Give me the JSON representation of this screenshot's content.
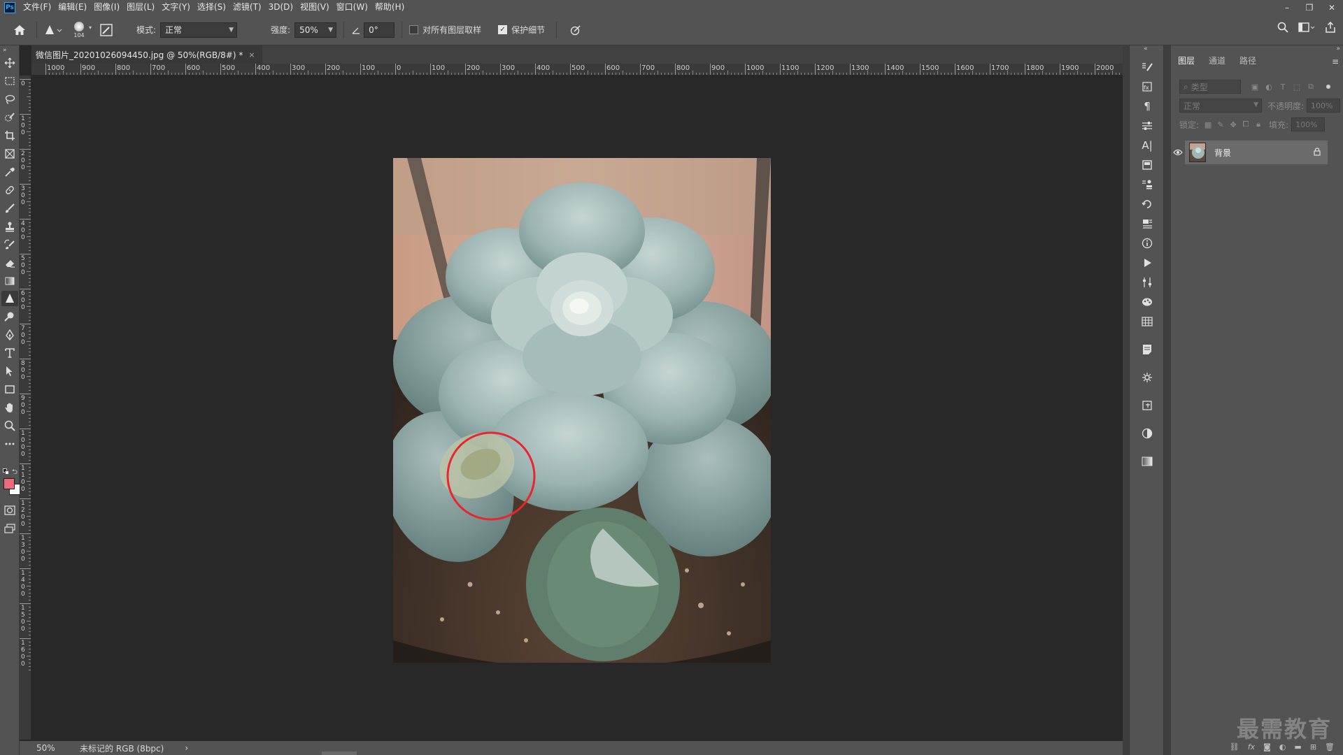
{
  "app": {
    "logo": "Ps"
  },
  "menu": [
    {
      "label": "文件(F)"
    },
    {
      "label": "编辑(E)"
    },
    {
      "label": "图像(I)"
    },
    {
      "label": "图层(L)"
    },
    {
      "label": "文字(Y)"
    },
    {
      "label": "选择(S)"
    },
    {
      "label": "滤镜(T)"
    },
    {
      "label": "3D(D)"
    },
    {
      "label": "视图(V)"
    },
    {
      "label": "窗口(W)"
    },
    {
      "label": "帮助(H)"
    }
  ],
  "window_controls": {
    "minimize": "–",
    "restore": "❐",
    "close": "✕"
  },
  "options": {
    "brush_size": "104",
    "mode_label": "模式:",
    "mode_value": "正常",
    "strength_label": "强度:",
    "strength_value": "50%",
    "angle_value": "0°",
    "sample_all_label": "对所有图层取样",
    "sample_all_checked": false,
    "protect_detail_label": "保护细节",
    "protect_detail_checked": true
  },
  "document": {
    "tab_title": "微信图片_20201026094450.jpg @ 50%(RGB/8#) *",
    "close_icon": "×",
    "ruler_top": [
      "1000",
      "900",
      "800",
      "700",
      "600",
      "500",
      "400",
      "300",
      "200",
      "100",
      "0",
      "100",
      "200",
      "300",
      "400",
      "500",
      "600",
      "700",
      "800",
      "900",
      "1000",
      "1100",
      "1200",
      "1300",
      "1400",
      "1500",
      "1600",
      "1700",
      "1800",
      "1900",
      "2000"
    ],
    "ruler_left": [
      "0",
      "1\n0\n0",
      "2\n0\n0",
      "3\n0\n0",
      "4\n0\n0",
      "5\n0\n0",
      "6\n0\n0",
      "7\n0\n0",
      "8\n0\n0",
      "9\n0\n0",
      "1\n0\n0\n0",
      "1\n1\n0\n0",
      "1\n2\n0\n0",
      "1\n3\n0\n0",
      "1\n4\n0\n0",
      "1\n5\n0\n0",
      "1\n6\n0\n0"
    ]
  },
  "status": {
    "zoom": "50%",
    "profile": "未标记的 RGB (8bpc)",
    "arrow": "›"
  },
  "layers_panel": {
    "tabs": [
      {
        "label": "图层"
      },
      {
        "label": "通道"
      },
      {
        "label": "路径"
      }
    ],
    "filter_placeholder": "类型",
    "blend_mode": "正常",
    "opacity_label": "不透明度:",
    "opacity_value": "100%",
    "lock_label": "锁定:",
    "fill_label": "填充:",
    "fill_value": "100%",
    "layers": [
      {
        "name": "背景",
        "locked": true,
        "visible": true
      }
    ],
    "footer_icons": [
      "link-icon",
      "fx-icon",
      "mask-icon",
      "adjustment-icon",
      "group-icon",
      "new-layer-icon",
      "trash-icon"
    ]
  },
  "watermark": "最需教育",
  "colors": {
    "foreground": "#f06a7e",
    "background": "#ffffff",
    "annotation_circle": "#e8262d"
  }
}
